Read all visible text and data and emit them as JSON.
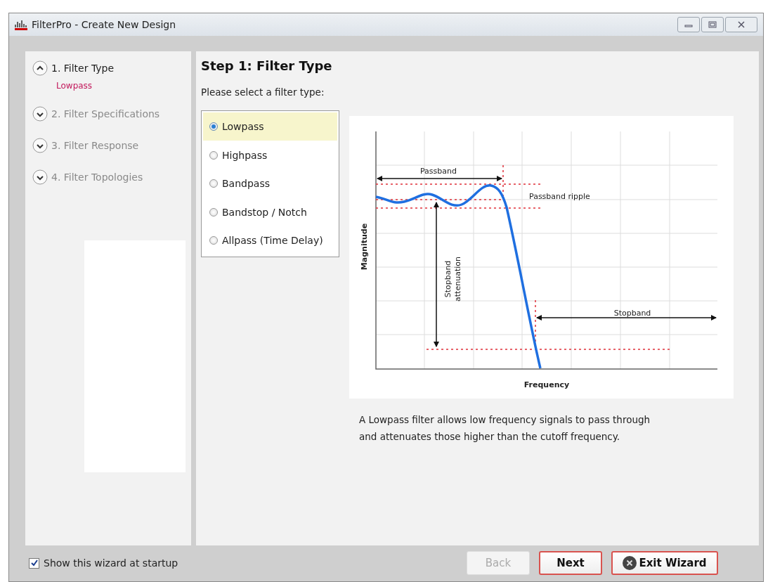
{
  "window": {
    "title": "FilterPro - Create New Design"
  },
  "steps": [
    {
      "label": "1. Filter Type",
      "selected": true,
      "expanded": true,
      "summary": "Lowpass"
    },
    {
      "label": "2. Filter Specifications",
      "selected": false,
      "expanded": false
    },
    {
      "label": "3. Filter Response",
      "selected": false,
      "expanded": false
    },
    {
      "label": "4. Filter Topologies",
      "selected": false,
      "expanded": false
    }
  ],
  "content": {
    "heading": "Step 1: Filter Type",
    "prompt": "Please select a filter type:",
    "filter_types": [
      {
        "label": "Lowpass",
        "selected": true
      },
      {
        "label": "Highpass",
        "selected": false
      },
      {
        "label": "Bandpass",
        "selected": false
      },
      {
        "label": "Bandstop / Notch",
        "selected": false
      },
      {
        "label": "Allpass (Time Delay)",
        "selected": false
      }
    ],
    "diagram": {
      "passband": "Passband",
      "passband_ripple": "Passband ripple",
      "stopband_attenuation": [
        "Stopband",
        "attenuation"
      ],
      "stopband": "Stopband",
      "ylabel": "Magnitude",
      "xlabel": "Frequency"
    },
    "description": [
      "A Lowpass filter allows low frequency signals to pass through",
      "and attenuates those higher than the cutoff frequency."
    ]
  },
  "footer": {
    "show_at_startup": {
      "label": "Show this wizard at startup",
      "checked": true
    },
    "buttons": [
      {
        "kind": "back",
        "label": "Back",
        "disabled": true
      },
      {
        "kind": "next",
        "label": "Next",
        "disabled": false
      },
      {
        "kind": "exit",
        "label": "Exit Wizard",
        "disabled": false
      }
    ]
  }
}
